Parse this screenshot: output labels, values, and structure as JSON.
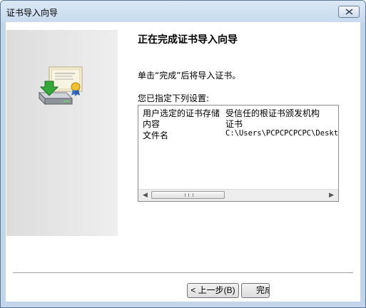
{
  "window": {
    "title": "证书导入向导"
  },
  "main": {
    "heading": "正在完成证书导入向导",
    "instruction": "单击“完成”后将导入证书。",
    "settings_label": "您已指定下列设置:",
    "settings": [
      {
        "name": "用户选定的证书存储",
        "value": "受信任的根证书颁发机构"
      },
      {
        "name": "内容",
        "value": "证书"
      },
      {
        "name": "文件名",
        "value": "C:\\Users\\PCPCPCPCPC\\Desktop"
      }
    ]
  },
  "buttons": {
    "back": "< 上一步(B)",
    "finish": "完成"
  },
  "icons": {
    "close": "close-icon",
    "wizard": "certificate-import-icon",
    "scroll_left": "scroll-left-arrow-icon",
    "scroll_right": "scroll-right-arrow-icon"
  }
}
